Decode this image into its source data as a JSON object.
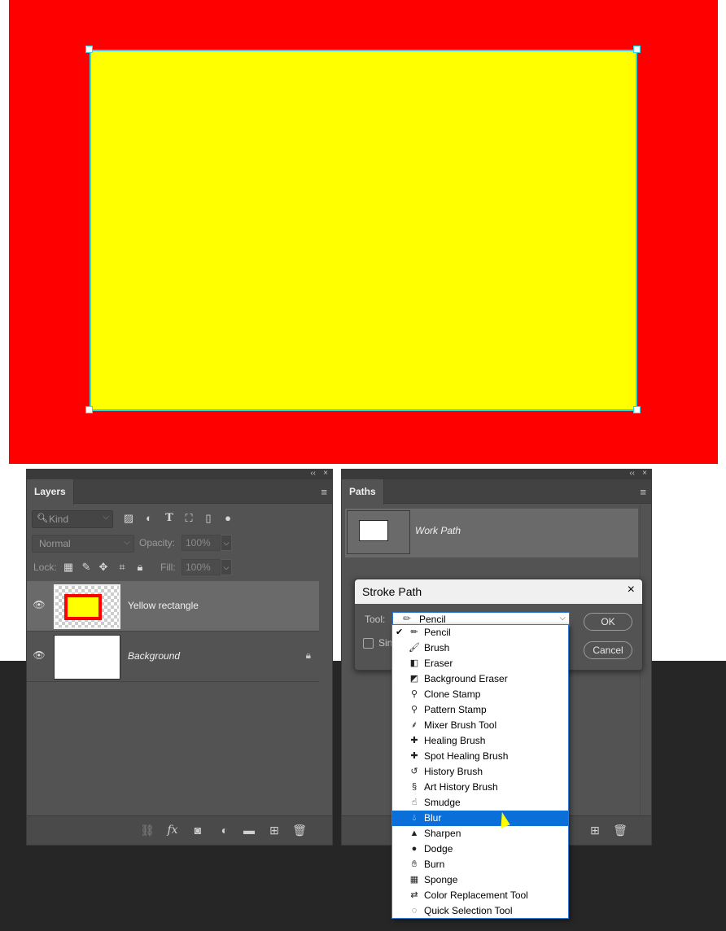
{
  "canvas": {
    "background_color": "#ff0000",
    "shape_fill": "#ffff00",
    "path_outline_color": "#2fd7e8"
  },
  "layers_panel": {
    "tab_label": "Layers",
    "collapse_glyph": "‹‹",
    "close_glyph": "×",
    "menu_glyph": "≡",
    "filter": {
      "placeholder": "Kind",
      "icons": [
        "image-filter-icon",
        "adjustment-filter-icon",
        "type-filter-icon",
        "shape-filter-icon",
        "smart-object-filter-icon",
        "filter-toggle-icon"
      ]
    },
    "blend_mode": "Normal",
    "opacity_label": "Opacity:",
    "opacity_value": "100%",
    "lock_label": "Lock:",
    "fill_label": "Fill:",
    "fill_value": "100%",
    "layers": [
      {
        "name": "Yellow rectangle",
        "visible": true,
        "selected": true,
        "locked": false
      },
      {
        "name": "Background",
        "visible": true,
        "selected": false,
        "locked": true
      }
    ],
    "footer_icons": [
      "link-layers-icon",
      "fx-icon",
      "add-mask-icon",
      "adjustment-layer-icon",
      "new-group-icon",
      "new-layer-icon",
      "delete-icon"
    ]
  },
  "paths_panel": {
    "tab_label": "Paths",
    "collapse_glyph": "‹‹",
    "close_glyph": "×",
    "menu_glyph": "≡",
    "paths": [
      {
        "name": "Work Path"
      }
    ],
    "footer_icons": [
      "new-path-icon",
      "delete-icon"
    ]
  },
  "stroke_dialog": {
    "title": "Stroke Path",
    "close_glyph": "×",
    "tool_label": "Tool:",
    "tool_value": "Pencil",
    "simulate_label": "Sin",
    "ok_label": "OK",
    "cancel_label": "Cancel"
  },
  "tool_dropdown": {
    "highlight_color": "#0a6fd8",
    "items": [
      {
        "label": "Pencil",
        "icon": "pencil-icon",
        "checked": true,
        "highlighted": false
      },
      {
        "label": "Brush",
        "icon": "brush-icon",
        "checked": false,
        "highlighted": false
      },
      {
        "label": "Eraser",
        "icon": "eraser-icon",
        "checked": false,
        "highlighted": false
      },
      {
        "label": "Background Eraser",
        "icon": "background-eraser-icon",
        "checked": false,
        "highlighted": false
      },
      {
        "label": "Clone Stamp",
        "icon": "clone-stamp-icon",
        "checked": false,
        "highlighted": false
      },
      {
        "label": "Pattern Stamp",
        "icon": "pattern-stamp-icon",
        "checked": false,
        "highlighted": false
      },
      {
        "label": "Mixer Brush Tool",
        "icon": "mixer-brush-icon",
        "checked": false,
        "highlighted": false
      },
      {
        "label": "Healing Brush",
        "icon": "healing-brush-icon",
        "checked": false,
        "highlighted": false
      },
      {
        "label": "Spot Healing Brush",
        "icon": "spot-healing-brush-icon",
        "checked": false,
        "highlighted": false
      },
      {
        "label": "History Brush",
        "icon": "history-brush-icon",
        "checked": false,
        "highlighted": false
      },
      {
        "label": "Art History Brush",
        "icon": "art-history-brush-icon",
        "checked": false,
        "highlighted": false
      },
      {
        "label": "Smudge",
        "icon": "smudge-icon",
        "checked": false,
        "highlighted": false
      },
      {
        "label": "Blur",
        "icon": "blur-icon",
        "checked": false,
        "highlighted": true
      },
      {
        "label": "Sharpen",
        "icon": "sharpen-icon",
        "checked": false,
        "highlighted": false
      },
      {
        "label": "Dodge",
        "icon": "dodge-icon",
        "checked": false,
        "highlighted": false
      },
      {
        "label": "Burn",
        "icon": "burn-icon",
        "checked": false,
        "highlighted": false
      },
      {
        "label": "Sponge",
        "icon": "sponge-icon",
        "checked": false,
        "highlighted": false
      },
      {
        "label": "Color Replacement Tool",
        "icon": "color-replacement-icon",
        "checked": false,
        "highlighted": false
      },
      {
        "label": "Quick Selection Tool",
        "icon": "quick-selection-icon",
        "checked": false,
        "highlighted": false
      }
    ]
  }
}
